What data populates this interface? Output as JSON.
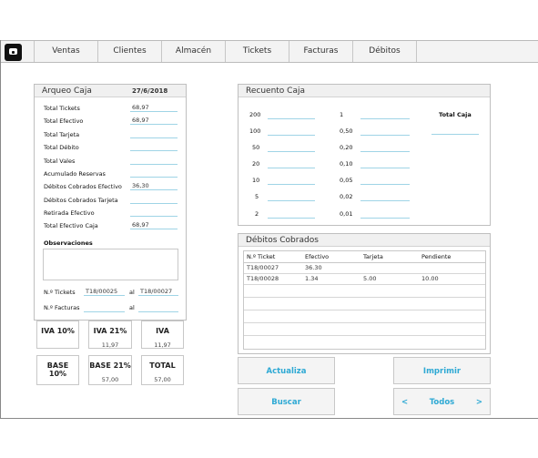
{
  "nav": {
    "tabs": [
      "Ventas",
      "Clientes",
      "Almacén",
      "Tickets",
      "Facturas",
      "Débitos"
    ]
  },
  "arqueo": {
    "title": "Arqueo Caja",
    "date": "27/6/2018",
    "rows": [
      {
        "label": "Total Tickets",
        "value": "68,97"
      },
      {
        "label": "Total Efectivo",
        "value": "68,97"
      },
      {
        "label": "Total Tarjeta",
        "value": ""
      },
      {
        "label": "Total Débito",
        "value": ""
      },
      {
        "label": "Total Vales",
        "value": ""
      },
      {
        "label": "Acumulado Reservas",
        "value": ""
      },
      {
        "label": "Débitos Cobrados Efectivo",
        "value": "36,30"
      },
      {
        "label": "Débitos Cobrados Tarjeta",
        "value": ""
      },
      {
        "label": "Retirada Efectivo",
        "value": ""
      },
      {
        "label": "Total Efectivo Caja",
        "value": "68,97"
      }
    ],
    "observaciones_label": "Observaciones",
    "tickets_label": "N.º Tickets",
    "tickets_from": "T18/00025",
    "tickets_sep": "al",
    "tickets_to": "T18/00027",
    "facturas_label": "N.º Facturas",
    "facturas_sep": "al"
  },
  "iva_boxes": [
    {
      "title": "IVA 10%",
      "value": ""
    },
    {
      "title": "IVA 21%",
      "value": "11,97"
    },
    {
      "title": "IVA",
      "value": "11,97"
    },
    {
      "title": "BASE 10%",
      "value": ""
    },
    {
      "title": "BASE 21%",
      "value": "57,00"
    },
    {
      "title": "TOTAL",
      "value": "57,00"
    }
  ],
  "recuento": {
    "title": "Recuento Caja",
    "left": [
      "200",
      "100",
      "50",
      "20",
      "10",
      "5",
      "2"
    ],
    "right": [
      "1",
      "0,50",
      "0,20",
      "0,10",
      "0,05",
      "0,02",
      "0,01"
    ],
    "total_label": "Total Caja"
  },
  "debitos": {
    "title": "Débitos Cobrados",
    "columns": [
      "N.º Ticket",
      "Efectivo",
      "Tarjeta",
      "Pendiente"
    ],
    "rows": [
      [
        "T18/00027",
        "36.30",
        "",
        ""
      ],
      [
        "T18/00028",
        "1.34",
        "5.00",
        "10.00"
      ]
    ]
  },
  "buttons": {
    "actualiza": "Actualiza",
    "imprimir": "Imprimir",
    "buscar": "Buscar",
    "prev": "<",
    "todos": "Todos",
    "next": ">"
  }
}
